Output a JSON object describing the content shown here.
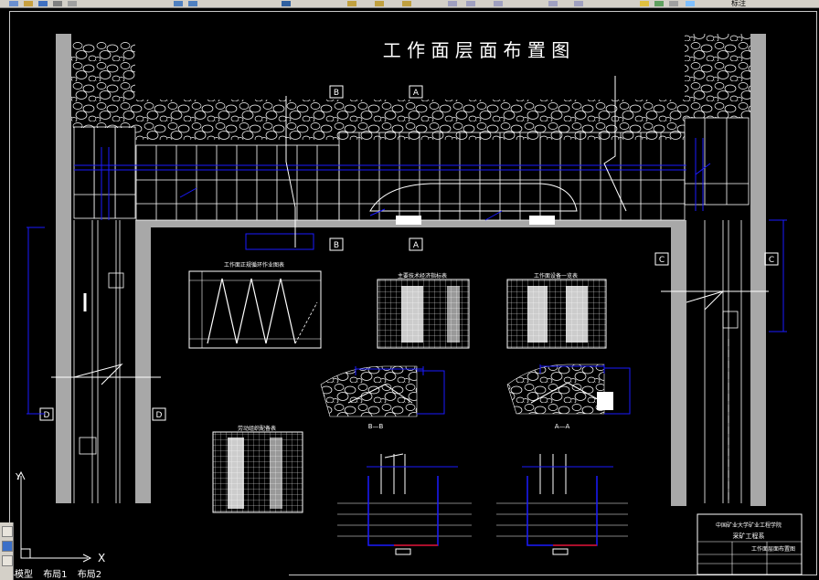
{
  "app": {
    "tabs": [
      "模型",
      "布局1",
      "布局2"
    ],
    "toolbar_right_text": "标注"
  },
  "drawing": {
    "title": "工 作 面 层 面 布 置 图",
    "section_markers": [
      "B",
      "A",
      "B",
      "A",
      "C",
      "C",
      "D",
      "D"
    ],
    "table_titles": [
      "工作面正规循环作业图表",
      "主要技术经济指标表",
      "工作面设备一览表",
      "劳动组织配备表"
    ],
    "section_labels": [
      "B—B",
      "A—A"
    ],
    "title_block": {
      "school": "中国矿业大学矿业工程学院",
      "department": "采矿工程系",
      "drawing_name": "工作面层面布置图"
    },
    "axis": {
      "x": "X",
      "y": "Y"
    },
    "colors": {
      "background": "#000000",
      "lines": "#ffffff",
      "dimension": "#1a1aff",
      "accent_red": "#e01010",
      "wall_gray": "#a8a8a8"
    }
  }
}
